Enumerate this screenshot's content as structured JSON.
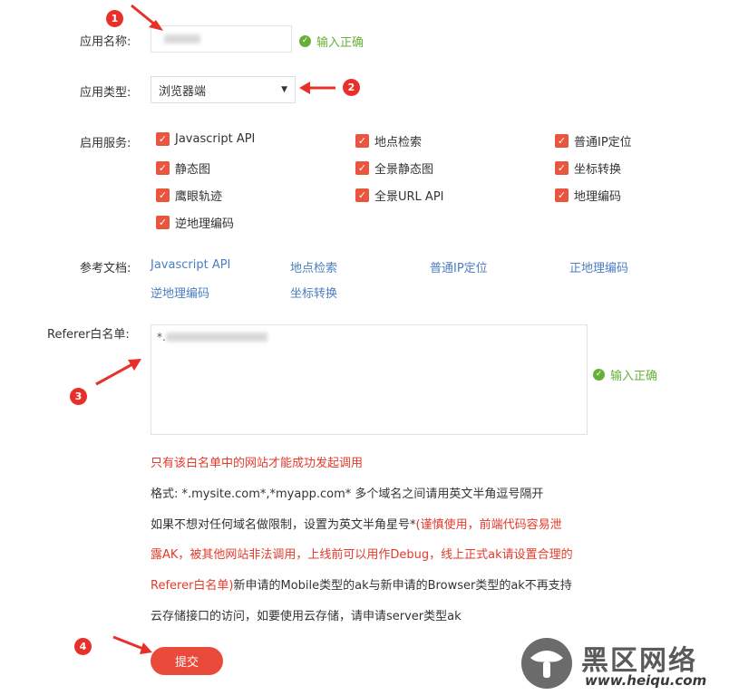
{
  "form": {
    "app_name": {
      "label": "应用名称:",
      "valid_text": "输入正确"
    },
    "app_type": {
      "label": "应用类型:",
      "selected": "浏览器端"
    },
    "services": {
      "label": "启用服务:",
      "items": [
        {
          "label": "Javascript API",
          "checked": true
        },
        {
          "label": "地点检索",
          "checked": true
        },
        {
          "label": "普通IP定位",
          "checked": true
        },
        {
          "label": "静态图",
          "checked": true
        },
        {
          "label": "全景静态图",
          "checked": true
        },
        {
          "label": "坐标转换",
          "checked": true
        },
        {
          "label": "鹰眼轨迹",
          "checked": true
        },
        {
          "label": "全景URL API",
          "checked": true
        },
        {
          "label": "地理编码",
          "checked": true
        },
        {
          "label": "逆地理编码",
          "checked": true
        }
      ]
    },
    "docs": {
      "label": "参考文档:",
      "links": [
        "Javascript API",
        "地点检索",
        "普通IP定位",
        "正地理编码",
        "逆地理编码",
        "坐标转换"
      ]
    },
    "referer": {
      "label": "Referer白名单:",
      "value_prefix": "*.",
      "valid_text": "输入正确"
    },
    "notes": {
      "line1": "只有该白名单中的网站才能成功发起调用",
      "line2": "格式: *.mysite.com*,*myapp.com* 多个域名之间请用英文半角逗号隔开",
      "line3_dark": "如果不想对任何域名做限制，设置为英文半角星号*",
      "line3_red": "(谨慎使用，前端代码容易泄",
      "line4_red": "露AK，被其他网站非法调用，上线前可以用作Debug，线上正式ak请设置合理的",
      "line5_red": "Referer白名单)",
      "line5_dark": "新申请的Mobile类型的ak与新申请的Browser类型的ak不再支持",
      "line6": "云存储接口的访问，如要使用云存储，请申请server类型ak"
    },
    "submit_label": "提交"
  },
  "annotations": [
    "1",
    "2",
    "3",
    "4"
  ],
  "watermark": {
    "title": "黑区网络",
    "url": "www.heiqu.com"
  },
  "colors": {
    "accent": "#e9553f",
    "valid": "#66b037",
    "link": "#4b7ec2",
    "badge": "#e8302a"
  }
}
